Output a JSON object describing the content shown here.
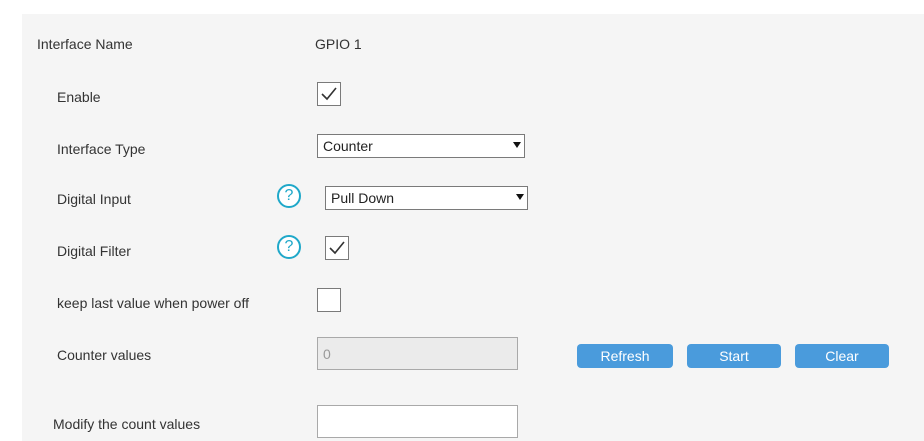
{
  "form": {
    "interface_name_label": "Interface Name",
    "interface_name_value": "GPIO 1",
    "enable_label": "Enable",
    "enable_checked": true,
    "interface_type_label": "Interface Type",
    "interface_type_value": "Counter",
    "digital_input_label": "Digital Input",
    "digital_input_value": "Pull Down",
    "digital_filter_label": "Digital Filter",
    "digital_filter_checked": true,
    "keep_last_label": "keep last value when power off",
    "keep_last_checked": false,
    "counter_values_label": "Counter values",
    "counter_values_value": "0",
    "modify_count_label": "Modify the count values",
    "modify_count_value": "",
    "help_glyph": "?"
  },
  "buttons": {
    "refresh": "Refresh",
    "start": "Start",
    "clear": "Clear"
  },
  "colors": {
    "accent": "#4a9bdc",
    "help": "#1fa8c9",
    "panel": "#f5f5f5"
  }
}
